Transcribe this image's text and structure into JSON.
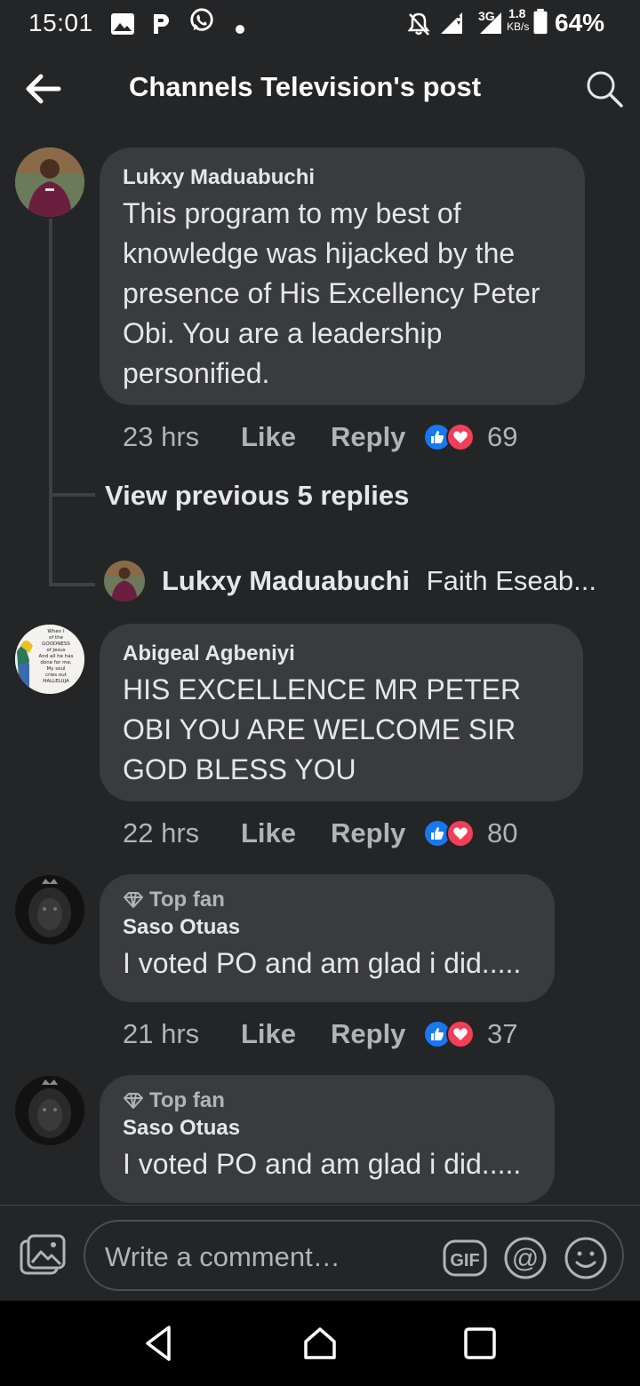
{
  "status_bar": {
    "time": "15:01",
    "left_icons": [
      "gallery-icon",
      "p-app-icon",
      "whatsapp-icon",
      "dot-icon"
    ],
    "network_label": "3G",
    "speed_value": "1.8",
    "speed_unit": "KB/s",
    "battery": "64%"
  },
  "header": {
    "title": "Channels Television's post"
  },
  "comments": [
    {
      "name": "Lukxy Maduabuchi",
      "text": "This program to my best of knowledge was hijacked by the presence of His Excellency Peter Obi. You are a leadership personified.",
      "age": "23 hrs",
      "like": "Like",
      "reply": "Reply",
      "reaction_count": "69"
    },
    {
      "name": "Abigeal Agbeniyi",
      "text": "HIS EXCELLENCE MR PETER OBI YOU ARE WELCOME SIR GOD BLESS YOU",
      "age": "22 hrs",
      "like": "Like",
      "reply": "Reply",
      "reaction_count": "80"
    },
    {
      "badge": "Top fan",
      "name": "Saso Otuas",
      "text": "I voted PO and am glad i did.....",
      "age": "21 hrs",
      "like": "Like",
      "reply": "Reply",
      "reaction_count": "37"
    },
    {
      "badge": "Top fan",
      "name": "Saso Otuas",
      "text": "I voted PO and am glad i did....."
    }
  ],
  "thread": {
    "view_previous": "View previous 5 replies",
    "reply_preview_name": "Lukxy Maduabuchi",
    "reply_preview_text": "Faith Eseab..."
  },
  "avatar_text": {
    "abigeal": [
      "When I",
      "of the",
      "GOODNESS",
      "of Jesus",
      "And all he has",
      "done for me,",
      "My soul",
      "cries out",
      "HALLELUJA"
    ]
  },
  "composer": {
    "placeholder": "Write a comment…",
    "gif_label": "GIF",
    "mention_label": "@"
  },
  "colors": {
    "background": "#242527",
    "bubble": "#3a3b3c",
    "text_primary": "#e4e6eb",
    "text_secondary": "#b0b3b8",
    "like_blue": "#1877f2",
    "love_red": "#f33e58"
  }
}
